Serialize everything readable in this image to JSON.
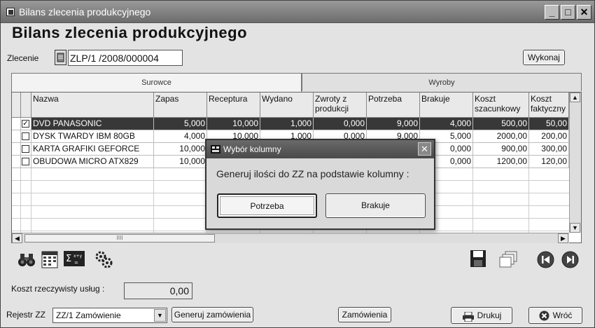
{
  "window": {
    "title": "Bilans zlecenia produkcyjnego"
  },
  "heading": "Bilans zlecenia produkcyjnego",
  "zlecenie": {
    "label": "Zlecenie",
    "value": "ZLP/1 /2008/000004"
  },
  "wykonaj_label": "Wykonaj",
  "tabs": [
    "Surowce",
    "Wyroby"
  ],
  "grid": {
    "columns": [
      "Nazwa",
      "Zapas",
      "Receptura",
      "Wydano",
      "Zwroty z produkcji",
      "Potrzeba",
      "Brakuje",
      "Koszt szacunkowy",
      "Koszt faktyczny"
    ],
    "rows": [
      {
        "checked": "✓",
        "cells": [
          "DVD PANASONIC",
          "5,000",
          "10,000",
          "1,000",
          "0,000",
          "9,000",
          "4,000",
          "500,00",
          "50,00"
        ]
      },
      {
        "checked": "",
        "cells": [
          "DYSK TWARDY IBM 80GB",
          "4,000",
          "10,000",
          "1,000",
          "0,000",
          "9,000",
          "5,000",
          "2000,00",
          "200,00"
        ]
      },
      {
        "checked": "",
        "cells": [
          "KARTA GRAFIKI GEFORCE",
          "10,000",
          "",
          "",
          "",
          "",
          "0,000",
          "900,00",
          "300,00"
        ]
      },
      {
        "checked": "",
        "cells": [
          "OBUDOWA  MICRO ATX829",
          "10,000",
          "",
          "",
          "",
          "",
          "0,000",
          "1200,00",
          "120,00"
        ]
      }
    ],
    "hscroll_grip": "IIII"
  },
  "dialog": {
    "title": "Wybór kolumny",
    "message": "Generuj ilości do ZZ na podstawie kolumny :",
    "btn_potrzeba": "Potrzeba",
    "btn_brakuje": "Brakuje",
    "close": "✕"
  },
  "koszt": {
    "label": "Koszt rzeczywisty usług :",
    "value": "0,00"
  },
  "rejestr": {
    "label": "Rejestr ZZ",
    "value": "ZZ/1  Zamówienie"
  },
  "generuj_label": "Generuj zamówienia",
  "zamowienia_label": "Zamówienia",
  "drukuj_label": "Drukuj",
  "wroc_label": "Wróć",
  "titlebar_buttons": {
    "min": "_",
    "max": "□",
    "close": "✕"
  },
  "icons": [
    "binoculars-icon",
    "calendar-grid-icon",
    "sigma-icon",
    "gears-icon",
    "save-icon",
    "copy-icon",
    "first-record-icon",
    "next-record-icon"
  ]
}
